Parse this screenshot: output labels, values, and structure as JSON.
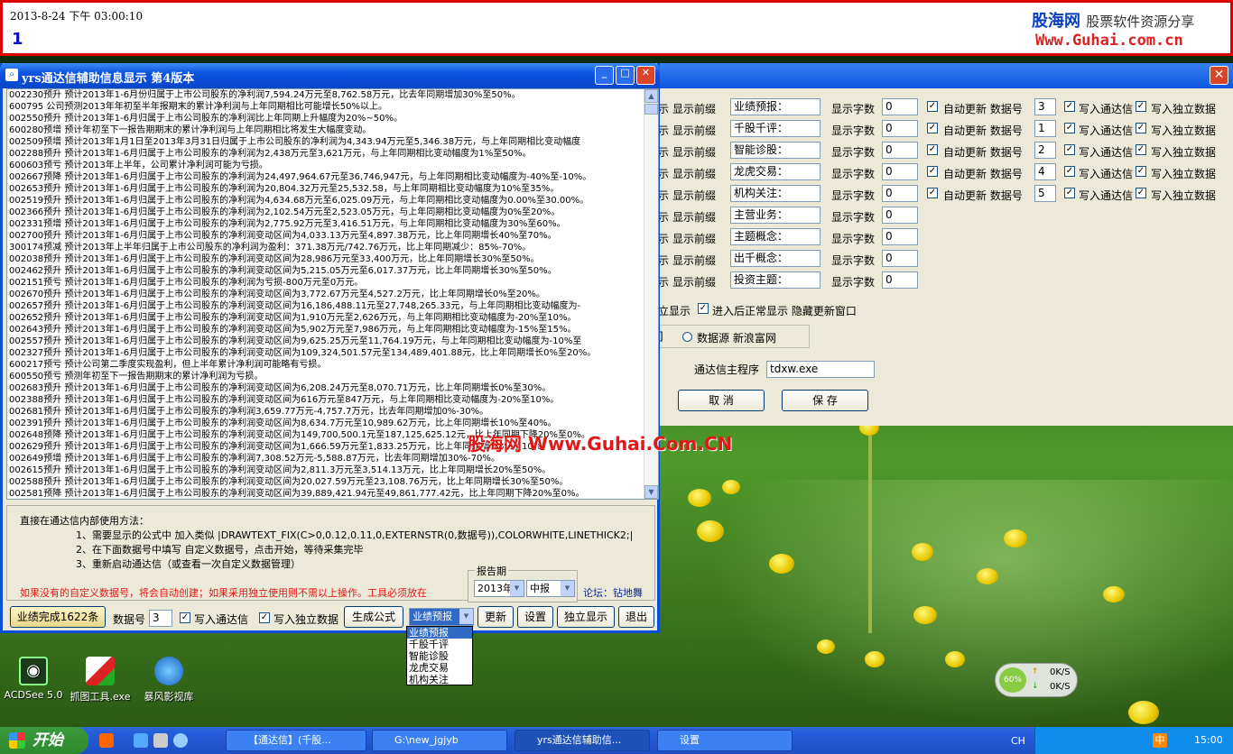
{
  "banner": {
    "datetime": "2013-8-24 下午 03:00:10",
    "value": "1",
    "brand_title": "股海网",
    "brand_slogan": "股票软件资源分享",
    "brand_url": "Www.Guhai.com.cn"
  },
  "settings_window": {
    "rows": [
      {
        "prefix": "示",
        "label": "显示前缀",
        "value": "业绩预报：",
        "count_label": "显示字数",
        "count": "0",
        "auto": "自动更新 数据号",
        "num": "3",
        "tdx": "写入通达信",
        "indep": "写入独立数据"
      },
      {
        "prefix": "示",
        "label": "显示前缀",
        "value": "千股千评：",
        "count_label": "显示字数",
        "count": "0",
        "auto": "自动更新 数据号",
        "num": "1",
        "tdx": "写入通达信",
        "indep": "写入独立数据"
      },
      {
        "prefix": "示",
        "label": "显示前缀",
        "value": "智能诊股：",
        "count_label": "显示字数",
        "count": "0",
        "auto": "自动更新 数据号",
        "num": "2",
        "tdx": "写入通达信",
        "indep": "写入独立数据"
      },
      {
        "prefix": "示",
        "label": "显示前缀",
        "value": "龙虎交易：",
        "count_label": "显示字数",
        "count": "0",
        "auto": "自动更新 数据号",
        "num": "4",
        "tdx": "写入通达信",
        "indep": "写入独立数据"
      },
      {
        "prefix": "示",
        "label": "显示前缀",
        "value": "机构关注：",
        "count_label": "显示字数",
        "count": "0",
        "auto": "自动更新 数据号",
        "num": "5",
        "tdx": "写入通达信",
        "indep": "写入独立数据"
      },
      {
        "prefix": "示",
        "label": "显示前缀",
        "value": "主营业务：",
        "count_label": "显示字数",
        "count": "0"
      },
      {
        "prefix": "示",
        "label": "显示前缀",
        "value": "主题概念：",
        "count_label": "显示字数",
        "count": "0"
      },
      {
        "prefix": "示",
        "label": "显示前缀",
        "value": "出千概念：",
        "count_label": "显示字数",
        "count": "0"
      },
      {
        "prefix": "示",
        "label": "显示前缀",
        "value": "投资主题：",
        "count_label": "显示字数",
        "count": "0"
      }
    ],
    "standalone": "立显示",
    "enter_normal": "进入后正常显示 隐藏更新窗口",
    "source_prefix": "]",
    "source": "数据源 新浪富网",
    "tdx_main_label": "通达信主程序",
    "tdx_main_value": "tdxw.exe",
    "cancel": "取 消",
    "save": "保 存"
  },
  "main_window": {
    "title": "yrs通达信辅助信息显示 第4版本",
    "lines": [
      "002230预升 预计2013年1-6月份归属于上市公司股东的净利润7,594.24万元至8,762.58万元，比去年同期增加30%至50%。",
      "600795 公司预测2013年年初至半年报期末的累计净利润与上年同期相比可能增长50%以上。",
      "002550预升 预计2013年1-6月归属于上市公司股东的净利润比上年同期上升幅度为20%~50%。",
      "600280预增 预计年初至下一报告期期末的累计净利润与上年同期相比将发生大幅度变动。",
      "002509预增 预计2013年1月1日至2013年3月31日归属于上市公司股东的净利润为4,343.94万元至5,346.38万元，与上年同期相比变动幅度",
      "002288预升 预计2013年1-6月归属于上市公司股东的净利润为2,438万元至3,621万元，与上年同期相比变动幅度为1%至50%。",
      "600603预亏 预计2013年上半年，公司累计净利润可能为亏损。",
      "002667预降 预计2013年1-6月归属于上市公司股东的净利润为24,497,964.67元至36,746,947元，与上年同期相比变动幅度为-40%至-10%。",
      "002653预升 预计2013年1-6月归属于上市公司股东的净利润为20,804.32万元至25,532.58，与上年同期相比变动幅度为10%至35%。",
      "002519预升 预计2013年1-6月归属于上市公司股东的净利润为4,634.68万元至6,025.09万元，与上年同期相比变动幅度为0.00%至30.00%。",
      "002366预升 预计2013年1-6月归属于上市公司股东的净利润为2,102.54万元至2,523.05万元，与上年同期相比变动幅度为0%至20%。",
      "002331预增 预计2013年1-6月归属于上市公司股东的净利润为2,775.92万元至3,416.51万元，与上年同期相比变动幅度为30%至60%。",
      "002700预升 预计2013年1-6月归属于上市公司股东的净利润变动区间为4,033.13万元至4,897.38万元，比上年同期增长40%至70%。",
      "300174预减 预计2013年上半年归属于上市公司股东的净利润为盈利：371.38万元/742.76万元，比上年同期减少：85%-70%。",
      "002038预升 预计2013年1-6月归属于上市公司股东的净利润变动区间为28,986万元至33,400万元，比上年同期增长30%至50%。",
      "002462预升 预计2013年1-6月归属于上市公司股东的净利润变动区间为5,215.05万元至6,017.37万元，比上年同期增长30%至50%。",
      "002151预亏 预计2013年1-6月归属于上市公司股东的净利润为亏损-800万元至0万元。",
      "002670预升 预计2013年1-6月归属于上市公司股东的净利润变动区间为3,772.67万元至4,527.2万元，比上年同期增长0%至20%。",
      "002657预升 预计2013年1-6月归属于上市公司股东的净利润变动区间为16,186,488.11元至27,748,265.33元，与上年同期相比变动幅度为-",
      "002652预升 预计2013年1-6月归属于上市公司股东的净利润变动区间为1,910万元至2,626万元，与上年同期相比变动幅度为-20%至10%。",
      "002643预升 预计2013年1-6月归属于上市公司股东的净利润变动区间为5,902万元至7,986万元，与上年同期相比变动幅度为-15%至15%。",
      "002557预升 预计2013年1-6月归属于上市公司股东的净利润变动区间为9,625.25万元至11,764.19万元，与上年同期相比变动幅度为-10%至",
      "002327预升 预计2013年1-6月归属于上市公司股东的净利润变动区间为109,324,501.57元至134,489,401.88元，比上年同期增长0%至20%。",
      "600217预亏 预计公司第二季度实现盈利，但上半年累计净利润可能略有亏损。",
      "600550预亏 预测年初至下一报告期期末的累计净利润为亏损。",
      "002683预升 预计2013年1-6月归属于上市公司股东的净利润变动区间为6,208.24万元至8,070.71万元，比上年同期增长0%至30%。",
      "002388预升 预计2013年1-6月归属于上市公司股东的净利润变动区间为616万元至847万元，与上年同期相比变动幅度为-20%至10%。",
      "002681预升 预计2013年1-6月归属于上市公司股东的净利润3,659.77万元-4,757.7万元，比去年同期增加0%-30%。",
      "002391预升 预计2013年1-6月归属于上市公司股东的净利润变动区间为8,634.7万元至10,989.62万元，比上年同期增长10%至40%。",
      "002648预降 预计2013年1-6月归属于上市公司股东的净利润变动区间为149,700,500.1元至187,125,625.12元，比上年同期下降20%至0%。",
      "002629预升 预计2013年1-6月归属于上市公司股东的净利润变动区间为1,666.59万元至1,833.25万元，比上年同期增长0%至10%。",
      "002649预增 预计2013年1-6月归属于上市公司股东的净利润7,308.52万元-5,588.87万元，比去年同期增加30%-70%。",
      "002615预升 预计2013年1-6月归属于上市公司股东的净利润变动区间为2,811.3万元至3,514.13万元，比上年同期增长20%至50%。",
      "002588预升 预计2013年1-6月归属于上市公司股东的净利润变动区间为20,027.59万元至23,108.76万元，比上年同期增长30%至50%。",
      "002581预降 预计2013年1-6月归属于上市公司股东的净利润变动区间为39,889,421.94元至49,861,777.42元，比上年同期下降20%至0%。"
    ],
    "watermark": "股海网 Www.Guhai.Com.CN",
    "instructions": {
      "title": "直接在通达信内部使用方法：",
      "step1": "1、需要显示的公式中 加入类似 |DRAWTEXT_FIX(C>0,0.12,0.11,0,EXTERNSTR(0,数据号)),COLORWHITE,LINETHICK2;|",
      "step2": "2、在下面数据号中填写 自定义数据号，点击开始，等待采集完毕",
      "step3": "3、重新启动通达信（或查看一次自定义数据管理）",
      "warning": "如果没有的自定义数据号，将会自动创建；如果采用独立使用则不需以上操作。工具必须放在",
      "forum": "论坛：钻地舞"
    },
    "report_period": {
      "label": "报告期",
      "year": "2013年",
      "period": "中报"
    },
    "bottom": {
      "status": "业绩完成1622条",
      "num_label": "数据号",
      "num_value": "3",
      "tdx": "写入通达信",
      "indep": "写入独立数据",
      "gen": "生成公式",
      "combo_value": "业绩预报",
      "update": "更新",
      "settings": "设置",
      "standalone": "独立显示",
      "exit": "退出"
    },
    "dropdown_options": [
      "业绩预报",
      "千股千评",
      "智能诊股",
      "龙虎交易",
      "机构关注"
    ]
  },
  "desktop_icons": [
    {
      "label": "ACDSee 5.0"
    },
    {
      "label": "抓图工具.exe"
    },
    {
      "label": "暴风影视库"
    }
  ],
  "net_meter": {
    "percent": "60%",
    "up": "0K/S",
    "down": "0K/S"
  },
  "taskbar": {
    "start": "开始",
    "tasks": [
      "【通达信】(千股...",
      "G:\\new_jgjyb",
      "yrs通达信辅助信...",
      "设置"
    ],
    "ime": "CH",
    "clock": "15:00",
    "tray_ime": "中"
  },
  "colors": {
    "accent_red": "#e00000",
    "titlebar_blue": "#0a52e0",
    "selection_blue": "#316ac5"
  }
}
